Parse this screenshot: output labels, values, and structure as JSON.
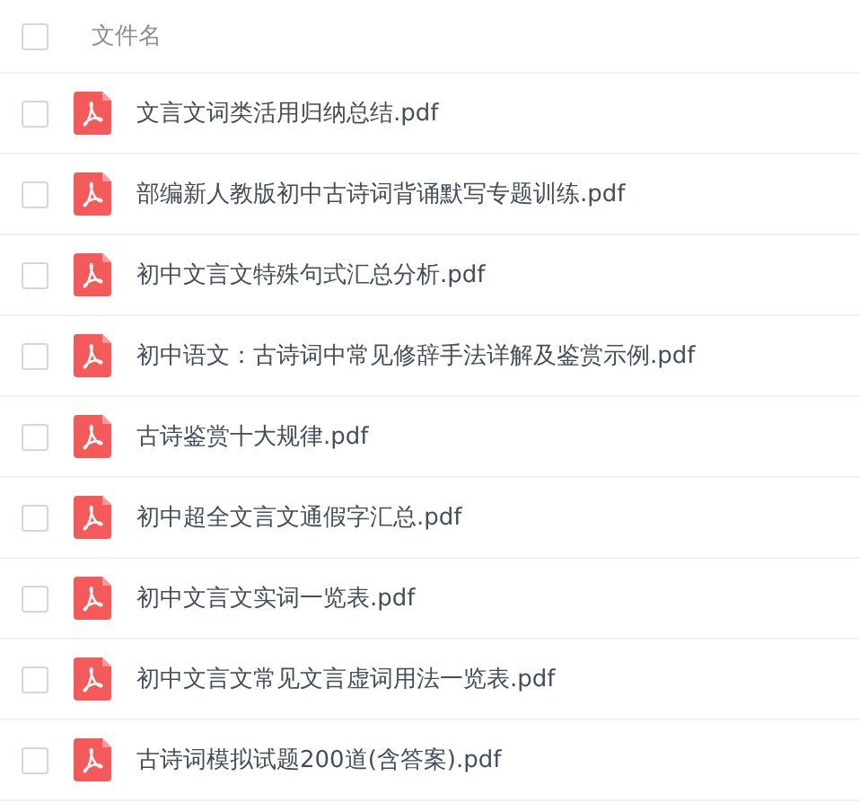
{
  "header": {
    "label": "文件名",
    "checked": false
  },
  "files": [
    {
      "name": "文言文词类活用归纳总结.pdf",
      "checked": false
    },
    {
      "name": "部编新人教版初中古诗词背诵默写专题训练.pdf",
      "checked": false
    },
    {
      "name": "初中文言文特殊句式汇总分析.pdf",
      "checked": false
    },
    {
      "name": "初中语文：古诗词中常见修辞手法详解及鉴赏示例.pdf",
      "checked": false
    },
    {
      "name": "古诗鉴赏十大规律.pdf",
      "checked": false
    },
    {
      "name": "初中超全文言文通假字汇总.pdf",
      "checked": false
    },
    {
      "name": "初中文言文实词一览表.pdf",
      "checked": false
    },
    {
      "name": "初中文言文常见文言虚词用法一览表.pdf",
      "checked": false
    },
    {
      "name": "古诗词模拟试题200道(含答案).pdf",
      "checked": false
    }
  ]
}
